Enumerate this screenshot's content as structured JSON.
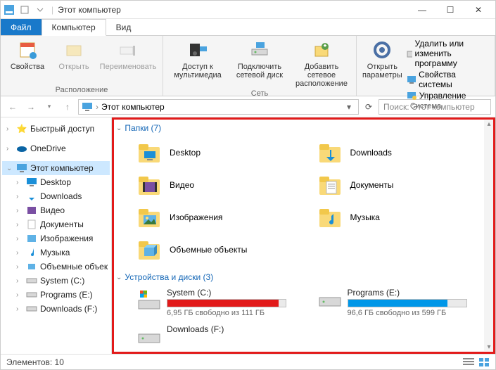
{
  "title": "Этот компьютер",
  "tabs": {
    "file": "Файл",
    "computer": "Компьютер",
    "view": "Вид"
  },
  "ribbon": {
    "location": {
      "props": "Свойства",
      "open": "Открыть",
      "rename": "Переименовать",
      "group": "Расположение"
    },
    "network": {
      "media": "Доступ к мультимедиа",
      "map": "Подключить сетевой диск",
      "addnet": "Добавить сетевое расположение",
      "group": "Сеть"
    },
    "system": {
      "settings": "Открыть параметры",
      "uninstall": "Удалить или изменить программу",
      "sysprops": "Свойства системы",
      "manage": "Управление",
      "group": "Система"
    }
  },
  "address": {
    "path": "Этот компьютер",
    "search_placeholder": "Поиск: Этот компьютер"
  },
  "tree": {
    "quick": "Быстрый доступ",
    "onedrive": "OneDrive",
    "thispc": "Этот компьютер",
    "items": [
      "Desktop",
      "Downloads",
      "Видео",
      "Документы",
      "Изображения",
      "Музыка",
      "Объемные объек",
      "System (C:)",
      "Programs (E:)",
      "Downloads (F:)"
    ]
  },
  "sections": {
    "folders": "Папки (7)",
    "devices": "Устройства и диски (3)"
  },
  "folders": [
    {
      "name": "Desktop",
      "icon": "desktop"
    },
    {
      "name": "Downloads",
      "icon": "downloads"
    },
    {
      "name": "Видео",
      "icon": "video"
    },
    {
      "name": "Документы",
      "icon": "documents"
    },
    {
      "name": "Изображения",
      "icon": "pictures"
    },
    {
      "name": "Музыка",
      "icon": "music"
    },
    {
      "name": "Объемные объекты",
      "icon": "3d"
    }
  ],
  "drives": [
    {
      "name": "System (C:)",
      "free": "6,95 ГБ свободно из 111 ГБ",
      "fill": 94,
      "color": "#e21a1a",
      "icon": "win"
    },
    {
      "name": "Programs (E:)",
      "free": "96,6 ГБ свободно из 599 ГБ",
      "fill": 84,
      "color": "#0097e8",
      "icon": "hdd"
    },
    {
      "name": "Downloads (F:)",
      "free": "",
      "fill": 0,
      "color": "#0097e8",
      "icon": "hdd"
    }
  ],
  "status": {
    "count": "Элементов: 10"
  }
}
